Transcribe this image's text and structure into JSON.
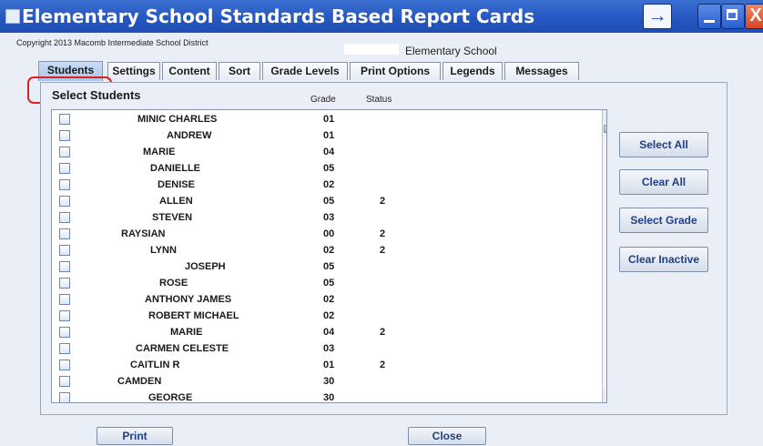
{
  "window": {
    "title": "Elementary School Standards Based Report Cards",
    "arrow_label": "→",
    "close_label": "X"
  },
  "header": {
    "copyright": "Copyright 2013 Macomb Intermediate School District",
    "school": "Elementary School"
  },
  "tabs": [
    {
      "label": "Students",
      "active": true
    },
    {
      "label": "Settings"
    },
    {
      "label": "Content"
    },
    {
      "label": "Sort"
    },
    {
      "label": "Grade Levels"
    },
    {
      "label": "Print Options"
    },
    {
      "label": "Legends"
    },
    {
      "label": "Messages"
    }
  ],
  "students_panel": {
    "title": "Select Students",
    "grade_header": "Grade",
    "status_header": "Status",
    "rows": [
      {
        "name": "MINIC CHARLES",
        "grade": "01",
        "status": ""
      },
      {
        "name": "ANDREW",
        "grade": "01",
        "status": ""
      },
      {
        "name": "MARIE",
        "grade": "04",
        "status": ""
      },
      {
        "name": "DANIELLE",
        "grade": "05",
        "status": ""
      },
      {
        "name": "DENISE",
        "grade": "02",
        "status": ""
      },
      {
        "name": "ALLEN",
        "grade": "05",
        "status": "2"
      },
      {
        "name": "STEVEN",
        "grade": "03",
        "status": ""
      },
      {
        "name": "RAYSIAN",
        "grade": "00",
        "status": "2"
      },
      {
        "name": "LYNN",
        "grade": "02",
        "status": "2"
      },
      {
        "name": "JOSEPH",
        "grade": "05",
        "status": ""
      },
      {
        "name": "ROSE",
        "grade": "05",
        "status": ""
      },
      {
        "name": "ANTHONY JAMES",
        "grade": "02",
        "status": ""
      },
      {
        "name": "ROBERT MICHAEL",
        "grade": "02",
        "status": ""
      },
      {
        "name": "MARIE",
        "grade": "04",
        "status": "2"
      },
      {
        "name": "CARMEN CELESTE",
        "grade": "03",
        "status": ""
      },
      {
        "name": "CAITLIN R",
        "grade": "01",
        "status": "2"
      },
      {
        "name": "CAMDEN",
        "grade": "30",
        "status": ""
      },
      {
        "name": "GEORGE",
        "grade": "30",
        "status": ""
      }
    ]
  },
  "side_buttons": {
    "select_all": "Select All",
    "clear_all": "Clear All",
    "select_grade": "Select Grade",
    "clear_inactive": "Clear Inactive"
  },
  "footer": {
    "print": "Print",
    "close": "Close"
  },
  "colors": {
    "titlebar": "#2456c0",
    "highlight": "#e02020",
    "button_text": "#1f3f86"
  }
}
